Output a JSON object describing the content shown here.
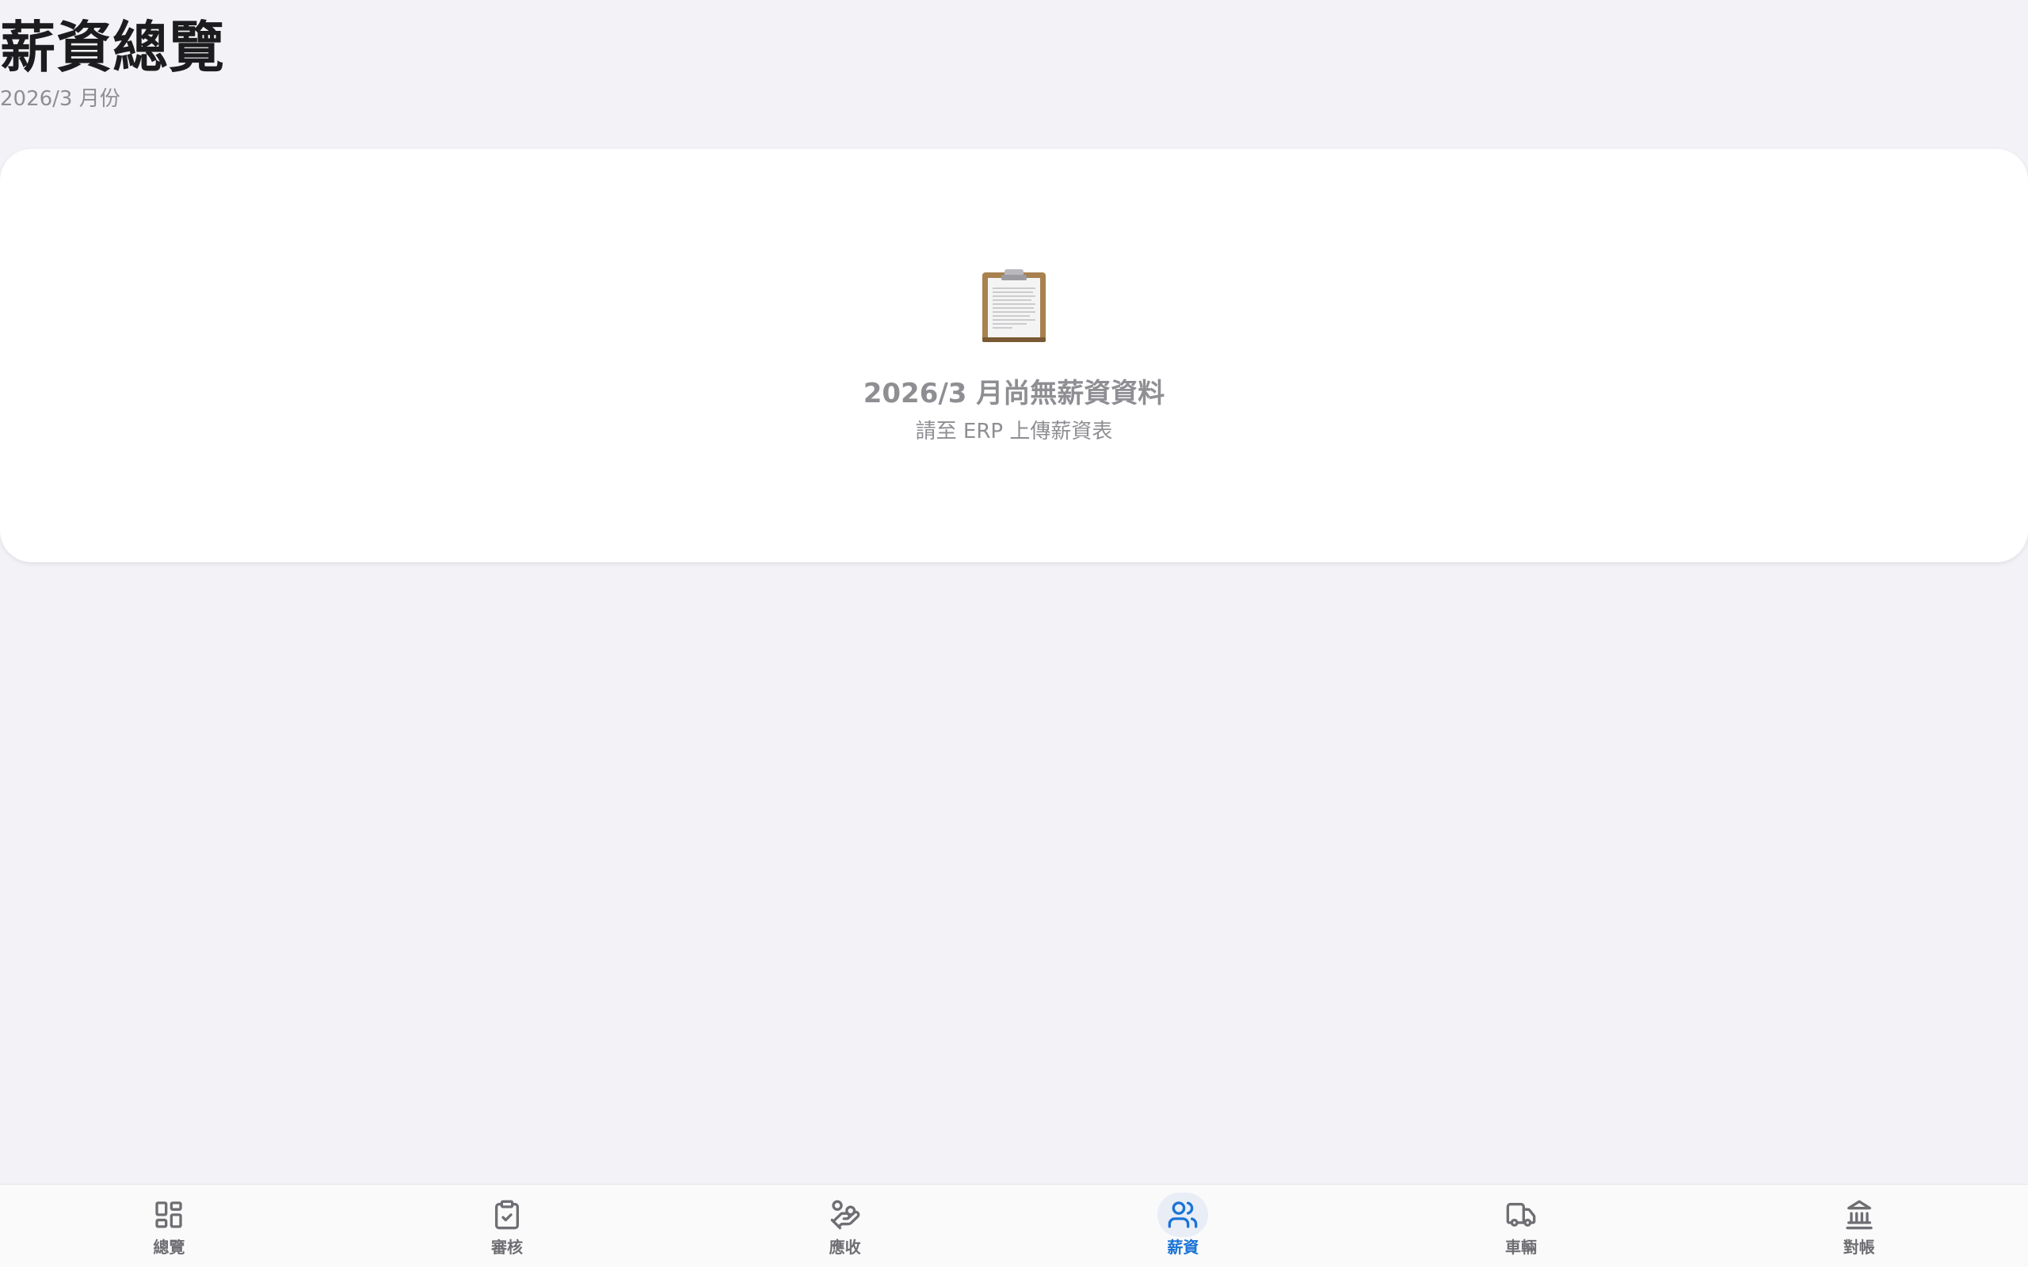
{
  "header": {
    "title": "薪資總覽",
    "subtitle": "2026/3 月份"
  },
  "empty_state": {
    "icon": "clipboard-icon",
    "title": "2026/3 月尚無薪資資料",
    "hint": "請至 ERP 上傳薪資表"
  },
  "tab_bar": {
    "active": "薪資",
    "accent_color": "#1a73d6",
    "items": [
      {
        "label": "總覽",
        "icon": "grid-icon"
      },
      {
        "label": "審核",
        "icon": "clipboard-check-icon"
      },
      {
        "label": "應收",
        "icon": "hand-coins-icon"
      },
      {
        "label": "薪資",
        "icon": "users-icon"
      },
      {
        "label": "車輛",
        "icon": "truck-icon"
      },
      {
        "label": "對帳",
        "icon": "bank-icon"
      }
    ]
  }
}
